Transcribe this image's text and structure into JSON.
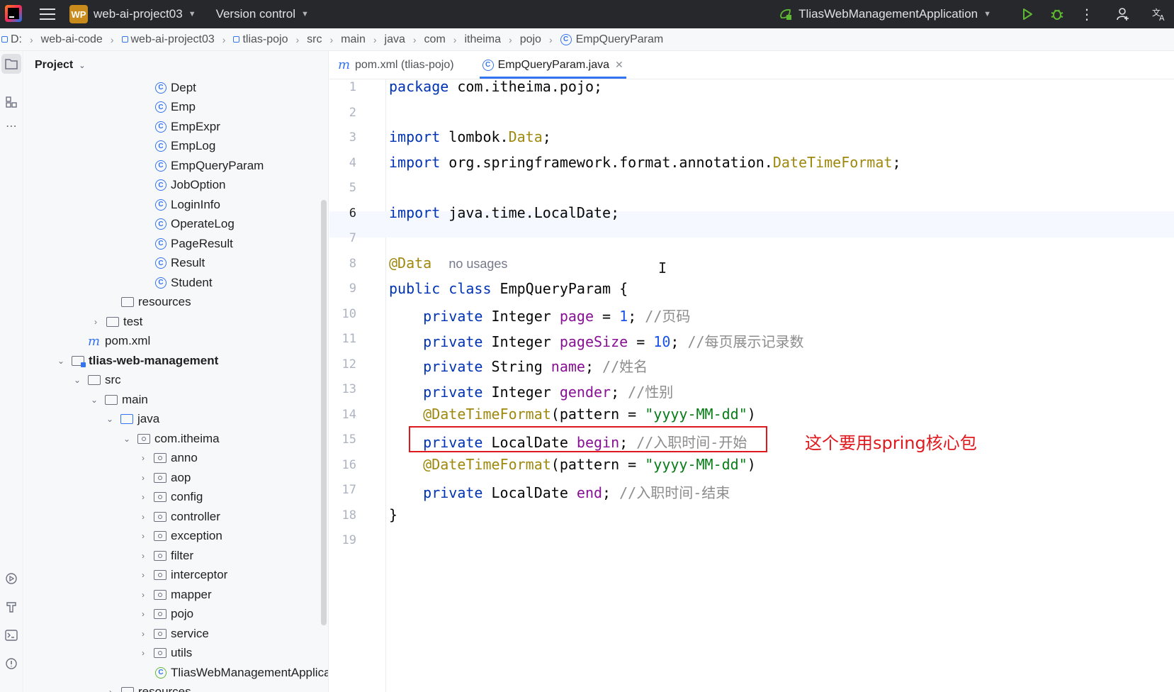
{
  "titlebar": {
    "project_badge": "WP",
    "project_name": "web-ai-project03",
    "version_control": "Version control",
    "run_config": "TliasWebManagementApplication"
  },
  "breadcrumb": [
    "D:",
    "web-ai-code",
    "web-ai-project03",
    "tlias-pojo",
    "src",
    "main",
    "java",
    "com",
    "itheima",
    "pojo",
    "EmpQueryParam"
  ],
  "project_panel": {
    "title": "Project",
    "tree": [
      {
        "label": "Dept",
        "kind": "class"
      },
      {
        "label": "Emp",
        "kind": "class"
      },
      {
        "label": "EmpExpr",
        "kind": "class"
      },
      {
        "label": "EmpLog",
        "kind": "class"
      },
      {
        "label": "EmpQueryParam",
        "kind": "class"
      },
      {
        "label": "JobOption",
        "kind": "class"
      },
      {
        "label": "LoginInfo",
        "kind": "class"
      },
      {
        "label": "OperateLog",
        "kind": "class"
      },
      {
        "label": "PageResult",
        "kind": "class"
      },
      {
        "label": "Result",
        "kind": "class"
      },
      {
        "label": "Student",
        "kind": "class"
      },
      {
        "label": "resources",
        "kind": "folder"
      },
      {
        "label": "test",
        "kind": "folder"
      },
      {
        "label": "pom.xml",
        "kind": "maven"
      },
      {
        "label": "tlias-web-management",
        "kind": "module"
      },
      {
        "label": "src",
        "kind": "folder"
      },
      {
        "label": "main",
        "kind": "folder"
      },
      {
        "label": "java",
        "kind": "folder"
      },
      {
        "label": "com.itheima",
        "kind": "package"
      },
      {
        "label": "anno",
        "kind": "package"
      },
      {
        "label": "aop",
        "kind": "package"
      },
      {
        "label": "config",
        "kind": "package"
      },
      {
        "label": "controller",
        "kind": "package"
      },
      {
        "label": "exception",
        "kind": "package"
      },
      {
        "label": "filter",
        "kind": "package"
      },
      {
        "label": "interceptor",
        "kind": "package"
      },
      {
        "label": "mapper",
        "kind": "package"
      },
      {
        "label": "pojo",
        "kind": "package"
      },
      {
        "label": "service",
        "kind": "package"
      },
      {
        "label": "utils",
        "kind": "package"
      },
      {
        "label": "TliasWebManagementApplica",
        "kind": "spring"
      },
      {
        "label": "resources",
        "kind": "folder"
      }
    ]
  },
  "tabs": [
    {
      "label": "pom.xml (tlias-pojo)",
      "active": false
    },
    {
      "label": "EmpQueryParam.java",
      "active": true
    }
  ],
  "editor": {
    "line_numbers": [
      "1",
      "2",
      "3",
      "4",
      "5",
      "6",
      "7",
      "8",
      "9",
      "10",
      "11",
      "12",
      "13",
      "14",
      "15",
      "16",
      "17",
      "18",
      "19"
    ],
    "current_line": "6",
    "tokens": {
      "package": "package",
      "import": "import",
      "public": "public",
      "class": "class",
      "private": "private",
      "l1_rest": " com.itheima.pojo;",
      "l3_pkg": " lombok.",
      "l3_cls": "Data",
      "l4_pkg": " org.springframework.format.annotation.",
      "l4_cls": "DateTimeFormat",
      "semi": ";",
      "l6_rest": " java.time.LocalDate;",
      "l8_ann": "@Data",
      "l8_hint": "no usages",
      "l9_name": " EmpQueryParam {",
      "t_integer": " Integer ",
      "t_string": " String ",
      "t_localdate": " LocalDate ",
      "f_page": "page",
      "f_pagesize": "pageSize",
      "f_name": "name",
      "f_gender": "gender",
      "f_begin": "begin",
      "f_end": "end",
      "eq": " = ",
      "v1": "1",
      "v10": "10",
      "c_page": " //页码",
      "c_pagesize": " //每页展示记录数",
      "c_name": " //姓名",
      "c_gender": " //性别",
      "c_begin": " //入职时间-开始",
      "c_end": " //入职时间-结束",
      "dtf": "@DateTimeFormat",
      "dtf_open": "(pattern = ",
      "dtf_str": "\"yyyy-MM-dd\"",
      "dtf_close": ")",
      "brace_close": "}"
    }
  },
  "annotation_note": "这个要用spring核心包",
  "colors": {
    "keyword": "#0033b3",
    "annotation": "#9e880d",
    "field": "#871094",
    "number": "#1750eb",
    "string": "#067d17",
    "comment": "#8c8c8c",
    "highlight_box": "#e0191f"
  }
}
